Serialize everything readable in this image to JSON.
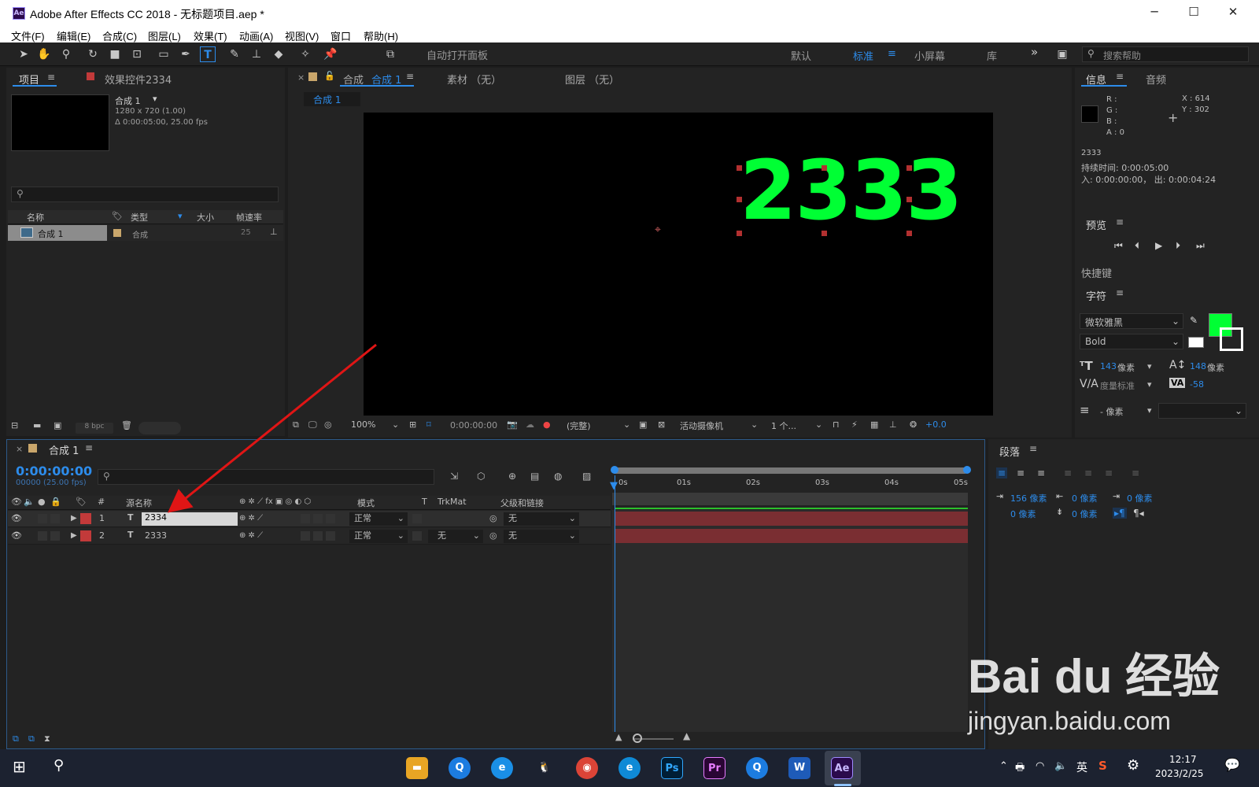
{
  "window": {
    "app_icon": "Ae",
    "title": "Adobe After Effects CC 2018 - 无标题项目.aep *",
    "min": "─",
    "max": "☐",
    "close": "✕"
  },
  "menu": [
    "文件(F)",
    "编辑(E)",
    "合成(C)",
    "图层(L)",
    "效果(T)",
    "动画(A)",
    "视图(V)",
    "窗口",
    "帮助(H)"
  ],
  "toolbar": {
    "auto_open_panel": "自动打开面板",
    "workspaces": [
      "默认",
      "标准",
      "小屏幕",
      "库"
    ],
    "active_workspace": "标准",
    "more": "»",
    "search_help": "搜索帮助"
  },
  "project": {
    "tab_project": "项目",
    "tab_effects": "效果控件2334",
    "comp_name": "合成 1",
    "comp_size": "1280 x 720 (1.00)",
    "comp_duration": "Δ 0:00:05:00, 25.00 fps",
    "columns": [
      "名称",
      "类型",
      "大小",
      "帧速率"
    ],
    "item_name": "合成 1",
    "item_type": "合成",
    "item_fps": "25",
    "bpc": "8 bpc"
  },
  "viewer": {
    "tab_comp": "合成",
    "tab_comp_name": "合成 1",
    "tab_footage": "素材 （无）",
    "tab_layer": "图层 （无）",
    "breadcrumb": "合成 1",
    "text": "2333",
    "zoom": "100%",
    "timecode": "0:00:00:00",
    "resolution": "(完整)",
    "camera": "活动摄像机",
    "views": "1 个...",
    "exposure": "+0.0"
  },
  "info": {
    "tab_info": "信息",
    "tab_audio": "音频",
    "r": "R :",
    "g": "G :",
    "b": "B :",
    "a": "A : 0",
    "x": "X : 614",
    "y": "Y : 302",
    "layer": "2333",
    "duration": "持续时间: 0:00:05:00",
    "inout": "入: 0:00:00:00， 出: 0:00:04:24"
  },
  "preview": {
    "title": "预览",
    "shortcut": "快捷键"
  },
  "character": {
    "title": "字符",
    "font": "微软雅黑",
    "style": "Bold",
    "size_value": "143",
    "size_unit": "像素",
    "leading_value": "148",
    "leading_unit": "像素",
    "kerning": "度量标准",
    "tracking": "-58",
    "stroke_value": "- 像素",
    "fill_color": "#00ff34"
  },
  "timeline": {
    "tab": "合成 1",
    "timecode": "0:00:00:00",
    "frames": "00000 (25.00 fps)",
    "col_hash": "#",
    "col_source": "源名称",
    "col_mode": "模式",
    "col_t": "T",
    "col_trkmat": "TrkMat",
    "col_parent": "父级和链接",
    "ruler": [
      "0s",
      "01s",
      "02s",
      "03s",
      "04s",
      "05s"
    ],
    "layers": [
      {
        "index": "1",
        "type": "T",
        "name": "2334",
        "mode": "正常",
        "trkmat": "",
        "parent": "无"
      },
      {
        "index": "2",
        "type": "T",
        "name": "2333",
        "mode": "正常",
        "trkmat": "无",
        "parent": "无"
      }
    ]
  },
  "paragraph": {
    "title": "段落",
    "indent_left": "156 像素",
    "indent_right": "0 像素",
    "indent_first": "0 像素",
    "space_before": "0 像素",
    "space_after": "0 像素",
    "zero": "0 像素"
  },
  "taskbar": {
    "icons": [
      "Ps",
      "Pr",
      "Ae"
    ],
    "ime": "英",
    "time": "12:17",
    "date": "2023/2/25"
  },
  "watermark": {
    "brand": "Bai du 经验",
    "url": "jingyan.baidu.com"
  }
}
